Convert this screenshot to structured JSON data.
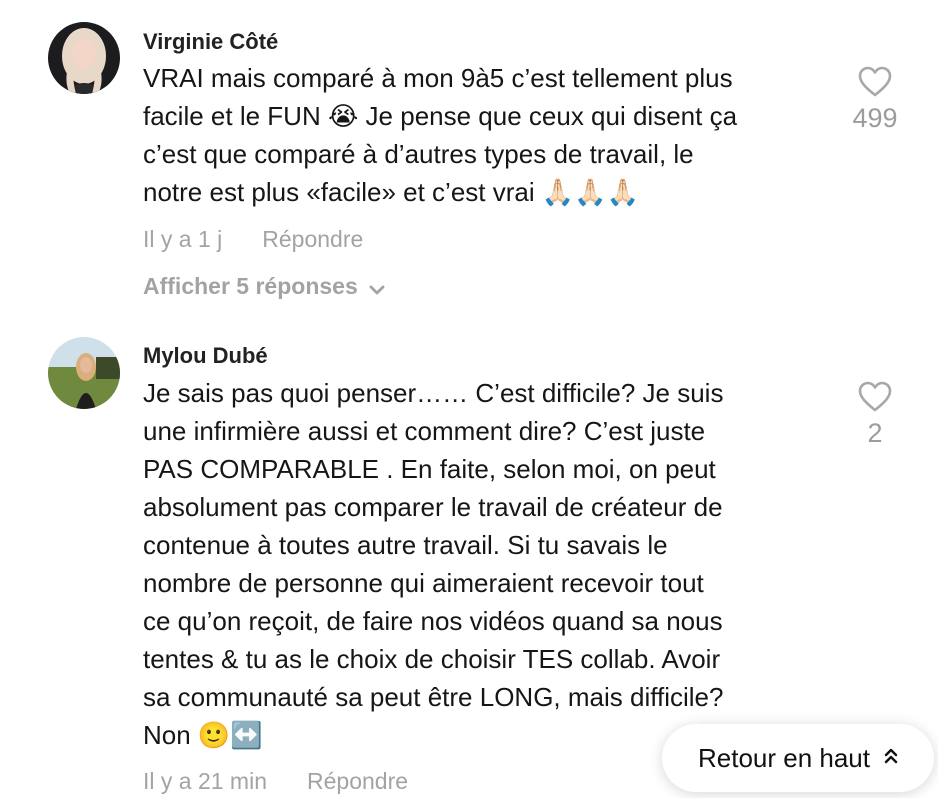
{
  "comments": [
    {
      "author": "Virginie Côté",
      "text": "VRAI mais comparé à mon 9à5 c’est tellement plus\nfacile et le FUN 😭 Je pense que ceux qui disent ça\nc’est que comparé à d’autres types de travail, le\nnotre est plus «facile» et c’est vrai 🙏🏻🙏🏻🙏🏻",
      "time": "Il y a 1 j",
      "reply_label": "Répondre",
      "likes": "499",
      "show_replies_label": "Afficher 5 réponses",
      "avatar_icon": "avatar-photo-blonde-woman",
      "avatar_colors": {
        "bg": "#1c1c1e",
        "hair": "#e8d8c8",
        "skin": "#f3d6c8"
      }
    },
    {
      "author": "Mylou Dubé",
      "text": "Je sais pas quoi penser…… C’est difficile? Je suis\nune infirmière aussi et comment dire? C’est juste\nPAS COMPARABLE . En faite, selon moi, on peut\nabsolument pas comparer le travail de créateur de\ncontenue à toutes autre travail. Si tu savais le\nnombre de personne qui aimeraient recevoir tout\nce qu’on reçoit, de faire nos vidéos quand sa nous\ntentes & tu as le choix de choisir TES collab. Avoir\nsa communauté sa peut être LONG, mais difficile?\nNon 🙂↔️",
      "time": "Il y a 21 min",
      "reply_label": "Répondre",
      "likes": "2",
      "avatar_icon": "avatar-photo-outdoor-woman",
      "avatar_colors": {
        "sky": "#cfe0ea",
        "grass": "#6f8a3e",
        "hair": "#d9b07a",
        "skin": "#e6b89c"
      }
    }
  ],
  "back_to_top": {
    "label": "Retour en haut",
    "icon": "double-chevron-up-icon"
  },
  "colors": {
    "meta_text": "#a3a3a3",
    "heart_stroke": "#a8a8a8",
    "like_count": "#9c9c9c"
  }
}
